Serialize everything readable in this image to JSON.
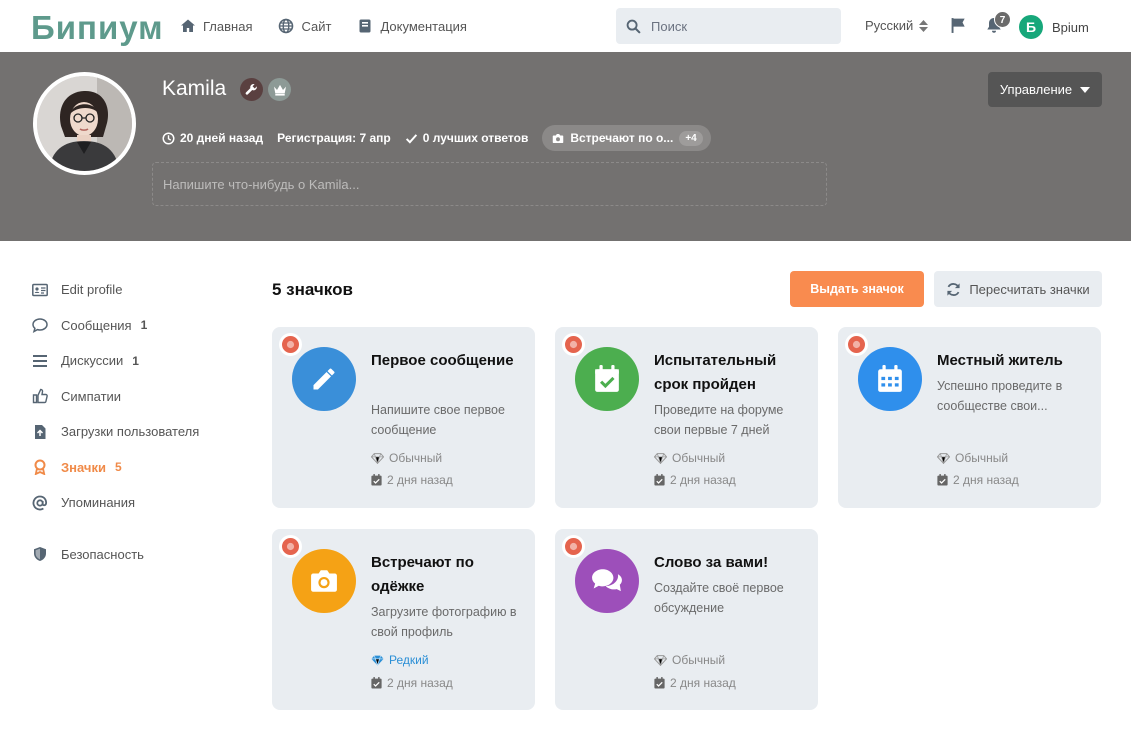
{
  "header": {
    "logo": "Бипиум",
    "nav": [
      {
        "label": "Главная",
        "icon": "home-icon"
      },
      {
        "label": "Сайт",
        "icon": "globe-icon"
      },
      {
        "label": "Документация",
        "icon": "book-icon"
      }
    ],
    "search_placeholder": "Поиск",
    "language": "Русский",
    "notifications_count": "7",
    "user_initial": "Б",
    "user_name": "Bpium"
  },
  "profile": {
    "name": "Kamila",
    "last_seen": "20 дней назад",
    "registration": "Регистрация: 7 апр",
    "best_answers": "0 лучших ответов",
    "badge_pill": "Встречают по о...",
    "badge_pill_more": "+4",
    "about_placeholder": "Напишите что-нибудь о Kamila...",
    "manage_label": "Управление"
  },
  "sidebar": {
    "items": [
      {
        "label": "Edit profile",
        "count": "",
        "icon": "id-card-icon"
      },
      {
        "label": "Сообщения",
        "count": "1",
        "icon": "comment-icon"
      },
      {
        "label": "Дискуссии",
        "count": "1",
        "icon": "bars-icon"
      },
      {
        "label": "Симпатии",
        "count": "",
        "icon": "thumbs-up-icon"
      },
      {
        "label": "Загрузки пользователя",
        "count": "",
        "icon": "upload-icon"
      },
      {
        "label": "Значки",
        "count": "5",
        "icon": "award-icon"
      },
      {
        "label": "Упоминания",
        "count": "",
        "icon": "at-icon"
      },
      {
        "label": "Безопасность",
        "count": "",
        "icon": "shield-icon"
      }
    ]
  },
  "main": {
    "title": "5 значков",
    "award_button": "Выдать значок",
    "recount_button": "Пересчитать значки"
  },
  "badges": [
    {
      "title": "Первое сообщение",
      "desc": "Напишите свое первое сообщение",
      "type": "Обычный",
      "date": "2 дня назад",
      "color": "#3a8fd9",
      "icon": "pencil-icon"
    },
    {
      "title": "Испытательный срок пройден",
      "desc": "Проведите на форуме свои первые 7 дней",
      "type": "Обычный",
      "date": "2 дня назад",
      "color": "#4cae4f",
      "icon": "calendar-check-icon"
    },
    {
      "title": "Местный житель",
      "desc": "Успешно проведите в сообществе свои...",
      "type": "Обычный",
      "date": "2 дня назад",
      "color": "#2f8fec",
      "icon": "calendar-icon"
    },
    {
      "title": "Встречают по одёжке",
      "desc": "Загрузите фотографию в свой профиль",
      "type": "Редкий",
      "date": "2 дня назад",
      "color": "#f5a215",
      "icon": "camera-icon"
    },
    {
      "title": "Слово за вами!",
      "desc": "Создайте своё первое обсуждение",
      "type": "Обычный",
      "date": "2 дня назад",
      "color": "#9d4fba",
      "icon": "comments-icon"
    }
  ]
}
